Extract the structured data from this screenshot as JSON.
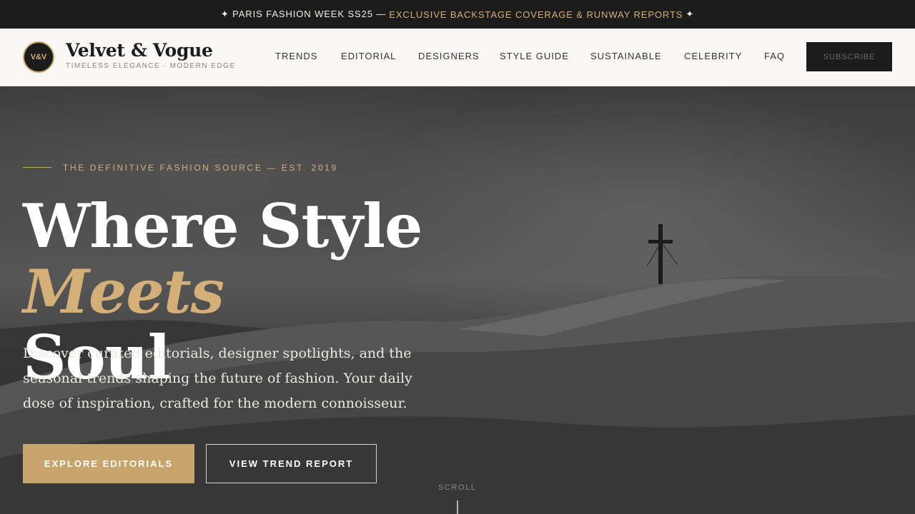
{
  "announcement": {
    "prefix": "✦ PARIS FASHION WEEK SS25 —",
    "highlight": "EXCLUSIVE BACKSTAGE COVERAGE & RUNWAY REPORTS",
    "suffix": "✦"
  },
  "brand": {
    "badge": "V&V",
    "name": "Velvet & Vogue",
    "tagline": "TIMELESS ELEGANCE · MODERN EDGE"
  },
  "nav": {
    "items": [
      {
        "label": "TRENDS"
      },
      {
        "label": "EDITORIAL"
      },
      {
        "label": "DESIGNERS"
      },
      {
        "label": "STYLE GUIDE"
      },
      {
        "label": "SUSTAINABLE"
      },
      {
        "label": "CELEBRITY"
      },
      {
        "label": "FAQ"
      }
    ],
    "subscribe_label": "SUBSCRIBE"
  },
  "hero": {
    "eyebrow": "THE DEFINITIVE FASHION SOURCE — EST. 2019",
    "headline_part1": "Where Style",
    "headline_accent": "Meets",
    "headline_part2": "Soul",
    "subcopy": "Discover curated editorials, designer spotlights, and the seasonal trends shaping the future of fashion. Your daily dose of inspiration, crafted for the modern connoisseur.",
    "primary_cta": "EXPLORE EDITORIALS",
    "secondary_cta": "VIEW TREND REPORT",
    "scroll_label": "SCROLL"
  },
  "colors": {
    "accent_gold": "#c7a46c",
    "dark": "#1c1c1c",
    "header_bg": "#f9f8f6"
  },
  "icons": {
    "announcement": "sparkle-icon",
    "hero_image": "mountain-summit-cross-image"
  }
}
